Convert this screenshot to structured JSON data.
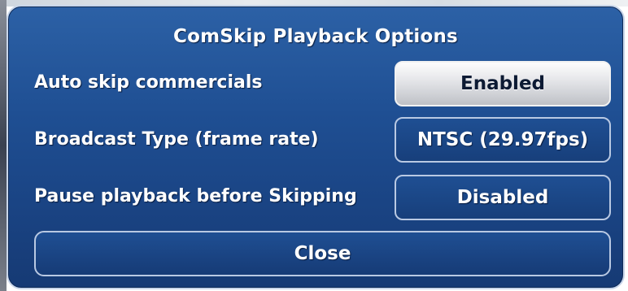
{
  "dialog": {
    "title": "ComSkip Playback Options",
    "rows": [
      {
        "label": "Auto skip commercials",
        "value": "Enabled",
        "focused": true
      },
      {
        "label": "Broadcast Type (frame rate)",
        "value": "NTSC (29.97fps)",
        "focused": false
      },
      {
        "label": "Pause playback before Skipping",
        "value": "Disabled",
        "focused": false
      }
    ],
    "close_label": "Close"
  },
  "colors": {
    "dialog_background": "#1f4f93",
    "dialog_border": "#c9d6ea",
    "button_border": "#b9c9e3",
    "focused_button_background": "#e6e7ea",
    "text": "#ffffff"
  }
}
